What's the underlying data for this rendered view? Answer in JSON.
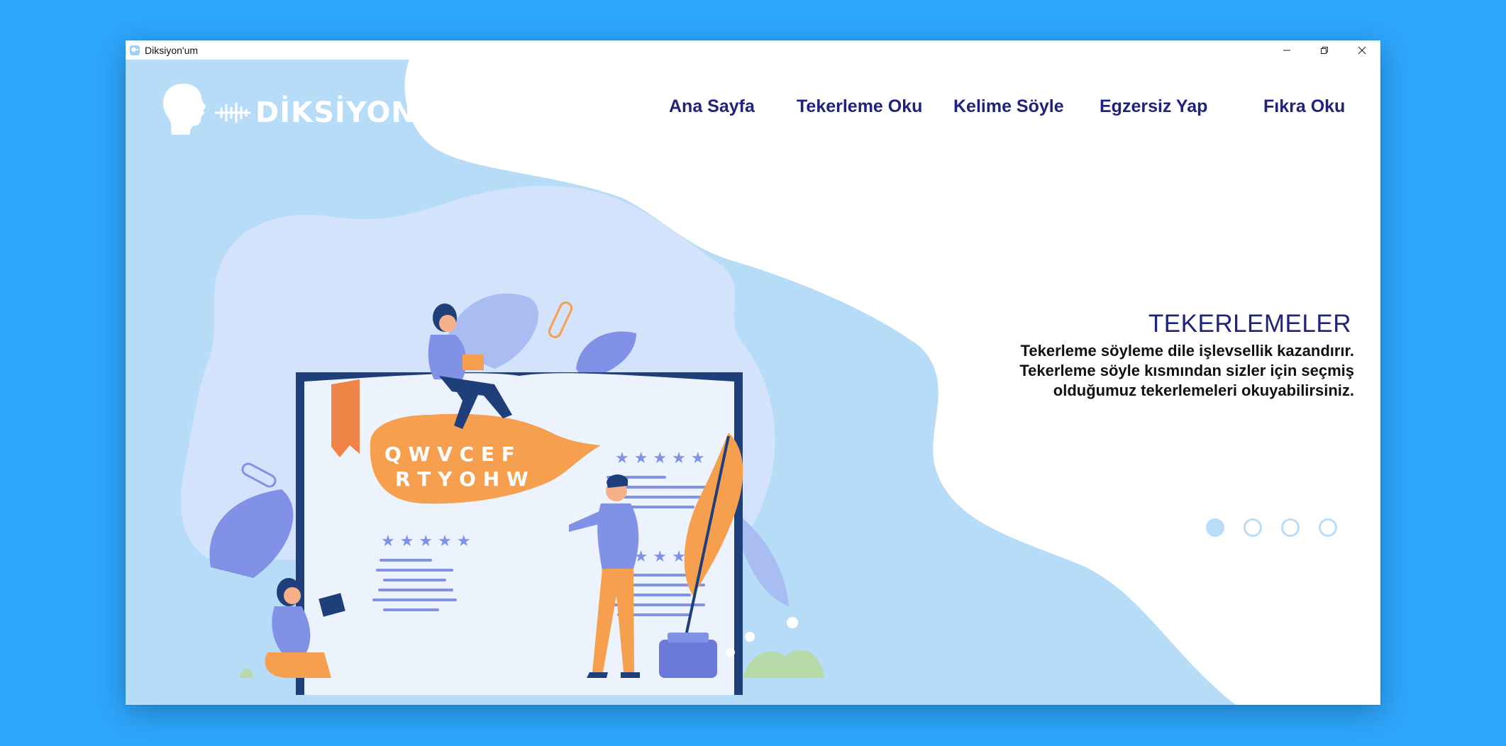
{
  "window": {
    "title": "Diksiyon'um",
    "icon": "app-icon"
  },
  "logo": {
    "text": "DİKSİYON'UM",
    "icons": [
      "head-profile-icon",
      "sound-wave-icon"
    ]
  },
  "nav": {
    "items": [
      {
        "label": "Ana Sayfa"
      },
      {
        "label": "Tekerleme Oku"
      },
      {
        "label": "Kelime Söyle"
      },
      {
        "label": "Egzersiz Yap"
      },
      {
        "label": "Fıkra Oku"
      }
    ]
  },
  "hero": {
    "title": "TEKERLEMELER",
    "description_lines": [
      "Tekerleme söyleme dile işlevsellik kazandırır.",
      "Tekerleme söyle kısmından sizler için seçmiş",
      "olduğumuz tekerlemeleri okuyabilirsiniz."
    ],
    "speech_bubble_letters": "QWVCEFRTYOHW"
  },
  "carousel": {
    "slide_count": 4,
    "active_index": 0
  },
  "colors": {
    "desktop": "#2ea6fd",
    "nav_text": "#20237b",
    "blob_light": "#b7dcf8",
    "blob_inner": "#d4e3fc",
    "accent_orange": "#f6a04f",
    "accent_purple": "#8191e6",
    "book_dark": "#1f3f7a"
  }
}
